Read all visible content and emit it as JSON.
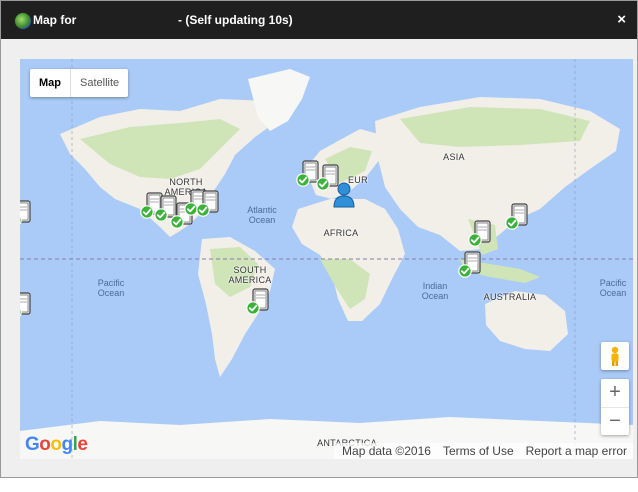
{
  "window": {
    "title": "Map for",
    "status": "- (Self updating 10s)",
    "close_label": "×"
  },
  "map": {
    "type_buttons": [
      "Map",
      "Satellite"
    ],
    "selected_type": "Map",
    "zoom_in": "+",
    "zoom_out": "−",
    "attribution": "Map data ©2016",
    "terms": "Terms of Use",
    "report": "Report a map error",
    "labels": {
      "north_america": "NORTH AMERICA",
      "south_america": "SOUTH AMERICA",
      "europe": "EUROPE",
      "africa": "AFRICA",
      "asia": "ASIA",
      "australia": "AUSTRALIA",
      "antarctica": "ANTARCTICA",
      "atlantic": "Atlantic Ocean",
      "pacific_east": "Pacific Ocean",
      "pacific_west": "Pacific Ocean",
      "indian": "Indian Ocean"
    }
  },
  "markers": [
    {
      "kind": "server",
      "status": "ok"
    },
    {
      "kind": "server",
      "status": "ok"
    },
    {
      "kind": "server",
      "status": "ok"
    },
    {
      "kind": "server",
      "status": "ok"
    },
    {
      "kind": "server",
      "status": "ok"
    },
    {
      "kind": "server",
      "status": "ok"
    },
    {
      "kind": "server",
      "status": "ok"
    },
    {
      "kind": "server",
      "status": "ok"
    },
    {
      "kind": "server",
      "status": "ok"
    },
    {
      "kind": "server",
      "status": "ok"
    },
    {
      "kind": "server",
      "status": "ok"
    },
    {
      "kind": "server",
      "status": "ok"
    },
    {
      "kind": "server",
      "status": "ok"
    },
    {
      "kind": "user",
      "status": "self"
    }
  ],
  "colors": {
    "titlebar": "#1f1f1f",
    "water": "#aacbf7",
    "land": "#f2efe9",
    "green_land": "#cfe5b8",
    "check": "#3bb33b"
  },
  "icons": [
    "globe-icon",
    "close-icon",
    "pegman-icon",
    "server-icon",
    "check-icon",
    "user-icon"
  ]
}
